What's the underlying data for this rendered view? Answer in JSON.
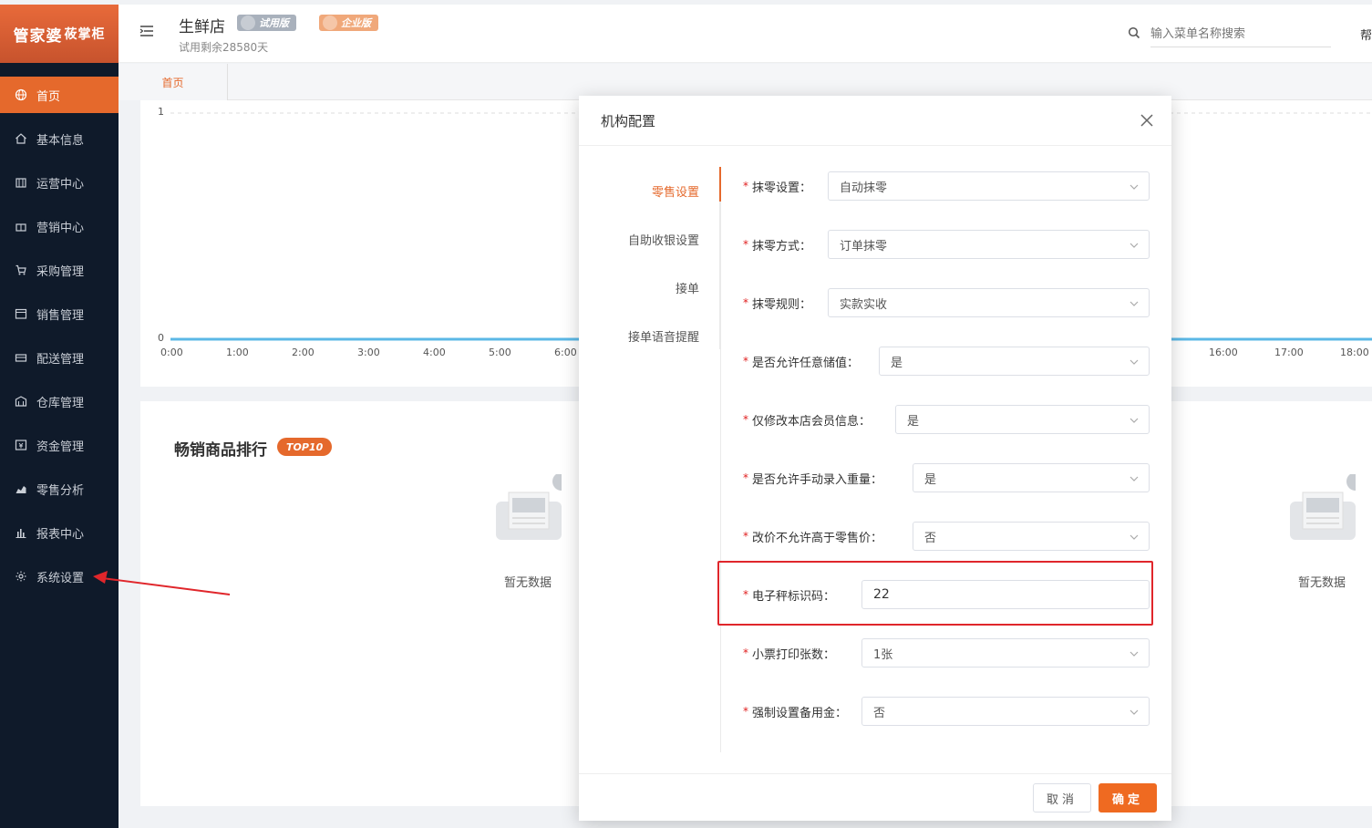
{
  "sidebar": {
    "logo_main": "管家婆",
    "logo_sub": "莜掌柜",
    "items": [
      {
        "label": "首页",
        "icon": "globe-icon",
        "active": true
      },
      {
        "label": "基本信息",
        "icon": "home-icon"
      },
      {
        "label": "运营中心",
        "icon": "store-icon"
      },
      {
        "label": "营销中心",
        "icon": "gift-icon"
      },
      {
        "label": "采购管理",
        "icon": "cart-icon"
      },
      {
        "label": "销售管理",
        "icon": "calendar-icon"
      },
      {
        "label": "配送管理",
        "icon": "truck-icon"
      },
      {
        "label": "仓库管理",
        "icon": "warehouse-icon"
      },
      {
        "label": "资金管理",
        "icon": "money-icon"
      },
      {
        "label": "零售分析",
        "icon": "area-chart-icon"
      },
      {
        "label": "报表中心",
        "icon": "bar-chart-icon"
      },
      {
        "label": "系统设置",
        "icon": "gear-icon"
      }
    ]
  },
  "header": {
    "store_name": "生鲜店",
    "badge_trial": "试用版",
    "badge_pro": "企业版",
    "trial_days": "试用剩余28580天",
    "search_placeholder": "输入菜单名称搜索",
    "help_label": "帮"
  },
  "tabs": [
    {
      "label": "首页"
    }
  ],
  "chart": {
    "y_top": "1",
    "y_bottom": "0",
    "x_left": [
      "0:00",
      "1:00",
      "2:00",
      "3:00",
      "4:00",
      "5:00",
      "6:00"
    ],
    "x_right": [
      "16:00",
      "17:00",
      "18:00"
    ]
  },
  "ranking": {
    "title": "畅销商品排行",
    "badge": "TOP10",
    "empty_left": "暂无数据",
    "empty_right": "暂无数据"
  },
  "modal": {
    "title": "机构配置",
    "tabs": [
      "零售设置",
      "自助收银设置",
      "接单",
      "接单语音提醒"
    ],
    "active_tab": "零售设置",
    "fields": {
      "rounding_setting": {
        "label": "抹零设置：",
        "value": "自动抹零"
      },
      "rounding_method": {
        "label": "抹零方式：",
        "value": "订单抹零"
      },
      "rounding_rule": {
        "label": "抹零规则：",
        "value": "实款实收"
      },
      "allow_any_stored_value": {
        "label": "是否允许任意储值：",
        "value": "是"
      },
      "only_edit_store_members": {
        "label": "仅修改本店会员信息：",
        "value": "是"
      },
      "allow_manual_weight": {
        "label": "是否允许手动录入重量：",
        "value": "是"
      },
      "no_price_above_retail": {
        "label": "改价不允许高于零售价：",
        "value": "否"
      },
      "scale_code": {
        "label": "电子秤标识码：",
        "value": "22"
      },
      "receipt_copies": {
        "label": "小票打印张数：",
        "value": "1张"
      },
      "force_reserve_fund": {
        "label": "强制设置备用金：",
        "value": "否"
      }
    },
    "cancel_label": "取消",
    "ok_label": "确定"
  },
  "colors": {
    "accent": "#e5692c",
    "sidebar_bg": "#0f1a2a",
    "highlight": "#e0262b"
  }
}
